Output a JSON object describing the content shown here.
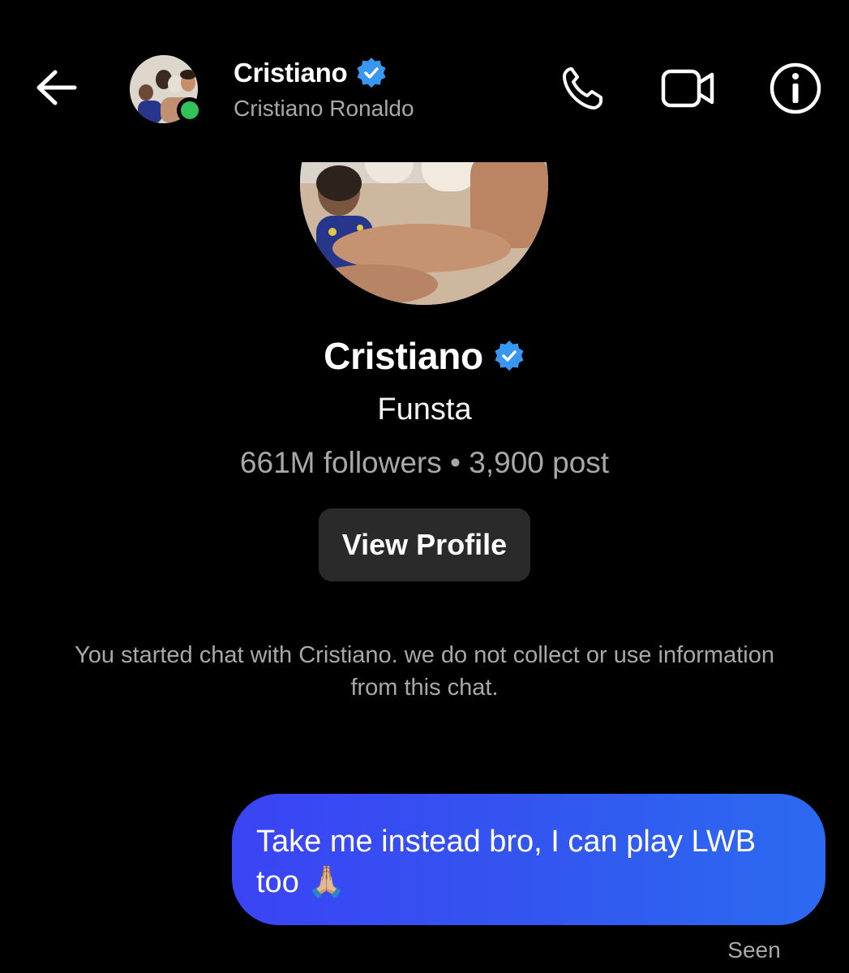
{
  "header": {
    "title": "Cristiano",
    "subtitle": "Cristiano Ronaldo",
    "online": true,
    "icons": [
      "back-arrow-icon",
      "phone-icon",
      "video-camera-icon",
      "info-icon"
    ]
  },
  "profile": {
    "name": "Cristiano",
    "verified": true,
    "tagline": "Funsta",
    "stats": "661M followers • 3,900 post",
    "view_profile_label": "View Profile"
  },
  "system_note": "You started chat with Cristiano. we do not collect or use information from this chat.",
  "messages": [
    {
      "from": "me",
      "text": "Take me instead bro, I can play LWB too 🙏🏼",
      "status": "Seen"
    }
  ],
  "colors": {
    "background": "#000000",
    "verified_blue": "#3897f0",
    "online_green": "#31c25a",
    "bubble_start": "#3b44f5",
    "bubble_end": "#2b6af0",
    "muted_text": "#a8a8a8",
    "button_bg": "#2a2a2a"
  }
}
